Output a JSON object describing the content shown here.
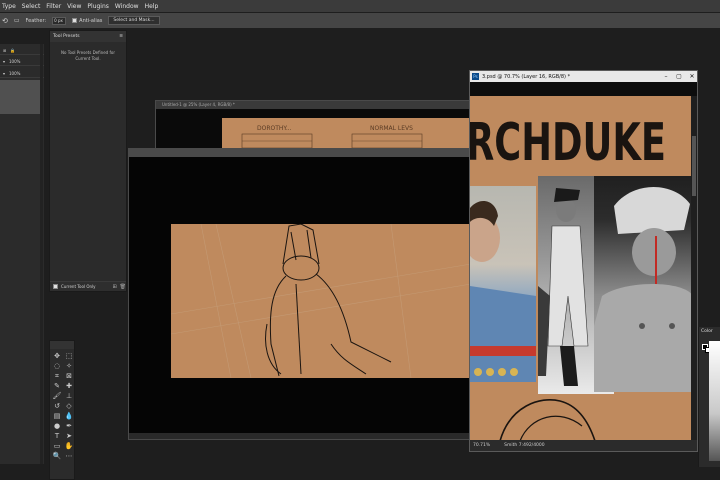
{
  "menu": [
    "Type",
    "Select",
    "Filter",
    "View",
    "Plugins",
    "Window",
    "Help"
  ],
  "options": {
    "feather_label": "Feather:",
    "feather_value": "0 px",
    "antialias_label": "Anti-alias",
    "select_mask_label": "Select and Mask..."
  },
  "left_panel": {
    "row1_value": "100%",
    "row2_value": "100%"
  },
  "tool_presets": {
    "title": "Tool Presets",
    "empty_text": "No Tool Presets Defined for Current Tool.",
    "footer_label": "Current Tool Only"
  },
  "doc1": {
    "tab_title": "Untitled-1 @ 25% (Layer 4, RGB/8) *",
    "label_left": "DOROTHY...",
    "label_right": "NORMAL LEVS"
  },
  "doc3": {
    "tab_title": "3.psd @ 70.7% (Layer 16, RGB/8) *",
    "headline": "RCHDUKE",
    "zoom": "70.71%",
    "doc_info": "Smith 7:492/4000"
  },
  "color_panel": {
    "title": "Color"
  },
  "colors": {
    "canvas": "#bf8a5e",
    "ui_bg": "#1e1e1e",
    "panel": "#2b2b2b"
  }
}
